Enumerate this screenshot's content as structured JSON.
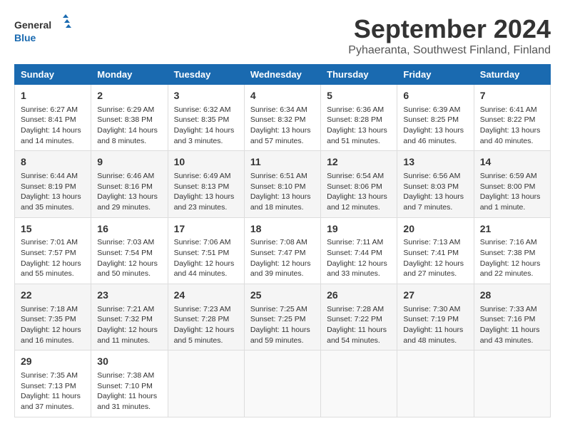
{
  "header": {
    "logo_general": "General",
    "logo_blue": "Blue",
    "month_title": "September 2024",
    "location": "Pyhaeranta, Southwest Finland, Finland"
  },
  "weekdays": [
    "Sunday",
    "Monday",
    "Tuesday",
    "Wednesday",
    "Thursday",
    "Friday",
    "Saturday"
  ],
  "weeks": [
    [
      {
        "day": "1",
        "info": "Sunrise: 6:27 AM\nSunset: 8:41 PM\nDaylight: 14 hours\nand 14 minutes."
      },
      {
        "day": "2",
        "info": "Sunrise: 6:29 AM\nSunset: 8:38 PM\nDaylight: 14 hours\nand 8 minutes."
      },
      {
        "day": "3",
        "info": "Sunrise: 6:32 AM\nSunset: 8:35 PM\nDaylight: 14 hours\nand 3 minutes."
      },
      {
        "day": "4",
        "info": "Sunrise: 6:34 AM\nSunset: 8:32 PM\nDaylight: 13 hours\nand 57 minutes."
      },
      {
        "day": "5",
        "info": "Sunrise: 6:36 AM\nSunset: 8:28 PM\nDaylight: 13 hours\nand 51 minutes."
      },
      {
        "day": "6",
        "info": "Sunrise: 6:39 AM\nSunset: 8:25 PM\nDaylight: 13 hours\nand 46 minutes."
      },
      {
        "day": "7",
        "info": "Sunrise: 6:41 AM\nSunset: 8:22 PM\nDaylight: 13 hours\nand 40 minutes."
      }
    ],
    [
      {
        "day": "8",
        "info": "Sunrise: 6:44 AM\nSunset: 8:19 PM\nDaylight: 13 hours\nand 35 minutes."
      },
      {
        "day": "9",
        "info": "Sunrise: 6:46 AM\nSunset: 8:16 PM\nDaylight: 13 hours\nand 29 minutes."
      },
      {
        "day": "10",
        "info": "Sunrise: 6:49 AM\nSunset: 8:13 PM\nDaylight: 13 hours\nand 23 minutes."
      },
      {
        "day": "11",
        "info": "Sunrise: 6:51 AM\nSunset: 8:10 PM\nDaylight: 13 hours\nand 18 minutes."
      },
      {
        "day": "12",
        "info": "Sunrise: 6:54 AM\nSunset: 8:06 PM\nDaylight: 13 hours\nand 12 minutes."
      },
      {
        "day": "13",
        "info": "Sunrise: 6:56 AM\nSunset: 8:03 PM\nDaylight: 13 hours\nand 7 minutes."
      },
      {
        "day": "14",
        "info": "Sunrise: 6:59 AM\nSunset: 8:00 PM\nDaylight: 13 hours\nand 1 minute."
      }
    ],
    [
      {
        "day": "15",
        "info": "Sunrise: 7:01 AM\nSunset: 7:57 PM\nDaylight: 12 hours\nand 55 minutes."
      },
      {
        "day": "16",
        "info": "Sunrise: 7:03 AM\nSunset: 7:54 PM\nDaylight: 12 hours\nand 50 minutes."
      },
      {
        "day": "17",
        "info": "Sunrise: 7:06 AM\nSunset: 7:51 PM\nDaylight: 12 hours\nand 44 minutes."
      },
      {
        "day": "18",
        "info": "Sunrise: 7:08 AM\nSunset: 7:47 PM\nDaylight: 12 hours\nand 39 minutes."
      },
      {
        "day": "19",
        "info": "Sunrise: 7:11 AM\nSunset: 7:44 PM\nDaylight: 12 hours\nand 33 minutes."
      },
      {
        "day": "20",
        "info": "Sunrise: 7:13 AM\nSunset: 7:41 PM\nDaylight: 12 hours\nand 27 minutes."
      },
      {
        "day": "21",
        "info": "Sunrise: 7:16 AM\nSunset: 7:38 PM\nDaylight: 12 hours\nand 22 minutes."
      }
    ],
    [
      {
        "day": "22",
        "info": "Sunrise: 7:18 AM\nSunset: 7:35 PM\nDaylight: 12 hours\nand 16 minutes."
      },
      {
        "day": "23",
        "info": "Sunrise: 7:21 AM\nSunset: 7:32 PM\nDaylight: 12 hours\nand 11 minutes."
      },
      {
        "day": "24",
        "info": "Sunrise: 7:23 AM\nSunset: 7:28 PM\nDaylight: 12 hours\nand 5 minutes."
      },
      {
        "day": "25",
        "info": "Sunrise: 7:25 AM\nSunset: 7:25 PM\nDaylight: 11 hours\nand 59 minutes."
      },
      {
        "day": "26",
        "info": "Sunrise: 7:28 AM\nSunset: 7:22 PM\nDaylight: 11 hours\nand 54 minutes."
      },
      {
        "day": "27",
        "info": "Sunrise: 7:30 AM\nSunset: 7:19 PM\nDaylight: 11 hours\nand 48 minutes."
      },
      {
        "day": "28",
        "info": "Sunrise: 7:33 AM\nSunset: 7:16 PM\nDaylight: 11 hours\nand 43 minutes."
      }
    ],
    [
      {
        "day": "29",
        "info": "Sunrise: 7:35 AM\nSunset: 7:13 PM\nDaylight: 11 hours\nand 37 minutes."
      },
      {
        "day": "30",
        "info": "Sunrise: 7:38 AM\nSunset: 7:10 PM\nDaylight: 11 hours\nand 31 minutes."
      },
      {
        "day": "",
        "info": ""
      },
      {
        "day": "",
        "info": ""
      },
      {
        "day": "",
        "info": ""
      },
      {
        "day": "",
        "info": ""
      },
      {
        "day": "",
        "info": ""
      }
    ]
  ]
}
